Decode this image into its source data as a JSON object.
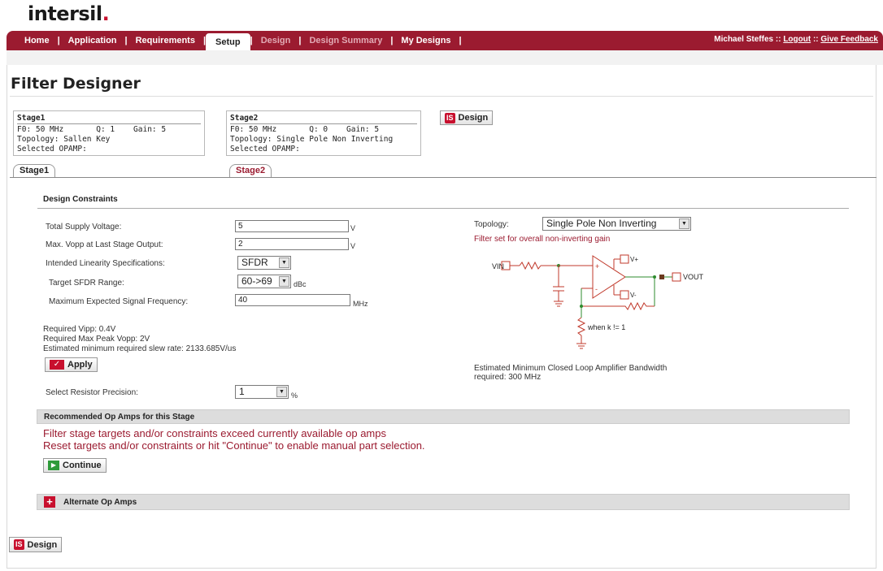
{
  "brand": {
    "logo_text": "intersil",
    "logo_dot": "."
  },
  "nav": {
    "items": [
      {
        "label": "Home"
      },
      {
        "label": "Application"
      },
      {
        "label": "Requirements"
      },
      {
        "label": "Setup",
        "active": true
      },
      {
        "label": "Design",
        "dim": true
      },
      {
        "label": "Design Summary",
        "dim": true
      },
      {
        "label": "My Designs"
      }
    ],
    "separator": "|",
    "user": "Michael Steffes",
    "divider": " :: ",
    "logout": "Logout",
    "feedback": "Give Feedback"
  },
  "page": {
    "title": "Filter Designer"
  },
  "stages": [
    {
      "title": "Stage1",
      "f0": "F0: 50 MHz",
      "q": "Q: 1",
      "gain": "Gain: 5",
      "topology": "Topology: Sallen Key",
      "opamp": "Selected OPAMP:"
    },
    {
      "title": "Stage2",
      "f0": "F0: 50 MHz",
      "q": "Q: 0",
      "gain": "Gain: 5",
      "topology": "Topology: Single Pole Non Inverting",
      "opamp": "Selected OPAMP:"
    }
  ],
  "design_button": {
    "icon": "IS",
    "label": "Design"
  },
  "tabs": [
    {
      "label": "Stage1"
    },
    {
      "label": "Stage2",
      "active": true
    }
  ],
  "constraints": {
    "title": "Design Constraints",
    "total_supply_label": "Total Supply Voltage:",
    "total_supply_value": "5",
    "total_supply_unit": "V",
    "max_vopp_label": "Max. Vopp at Last Stage Output:",
    "max_vopp_value": "2",
    "max_vopp_unit": "V",
    "linearity_label": "Intended Linearity Specifications:",
    "linearity_value": "SFDR",
    "sfdr_label": "Target SFDR Range:",
    "sfdr_value": "60->69",
    "sfdr_unit": "dBc",
    "max_freq_label": "Maximum Expected Signal Frequency:",
    "max_freq_value": "40",
    "max_freq_unit": "MHz",
    "req_vipp": "Required Vipp: 0.4V",
    "req_vopp": "Required Max Peak Vopp: 2V",
    "slew_rate": "Estimated minimum required slew rate: 2133.685V/us",
    "apply_label": "Apply",
    "resistor_label": "Select Resistor Precision:",
    "resistor_value": "1",
    "resistor_unit": "%"
  },
  "topology": {
    "label": "Topology:",
    "value": "Single Pole Non Inverting",
    "note": "Filter set for overall non-inverting gain",
    "bandwidth_line1": "Estimated Minimum Closed Loop Amplifier Bandwidth",
    "bandwidth_line2": "required: 300 MHz",
    "schematic": {
      "vin": "VIN",
      "vout": "VOUT",
      "vplus": "V+",
      "vminus": "V-",
      "k_note": "when k != 1"
    }
  },
  "recommended": {
    "title": "Recommended Op Amps for this Stage",
    "msg1": "Filter stage targets and/or constraints exceed currently available op amps",
    "msg2": "Reset targets and/or constraints or hit \"Continue\" to enable manual part selection.",
    "continue_label": "Continue"
  },
  "alternate": {
    "title": "Alternate Op Amps"
  },
  "colors": {
    "brand": "#9b1b30",
    "accent_red": "#c8102e",
    "schematic_red": "#c0392b",
    "schematic_green": "#2e8b2e"
  }
}
